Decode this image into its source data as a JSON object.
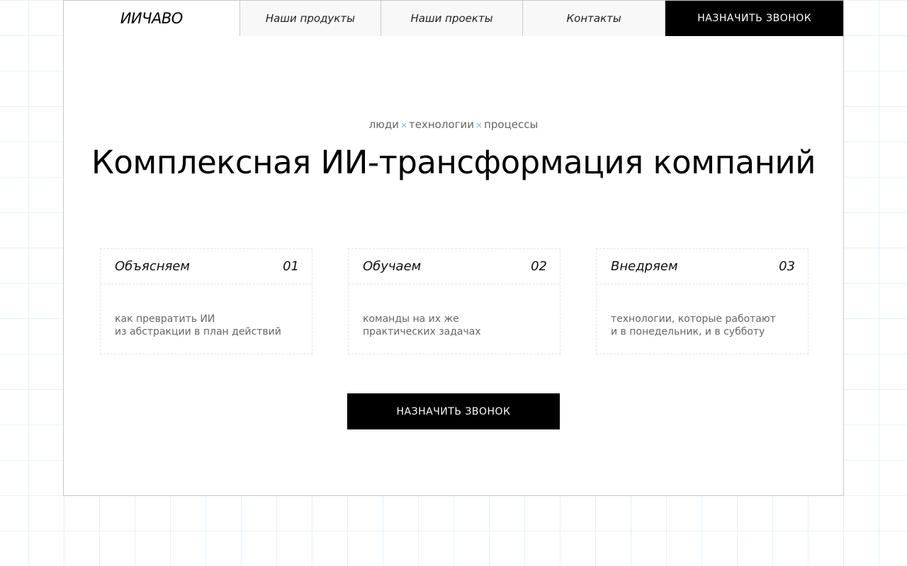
{
  "nav": {
    "logo": "ИИЧАВО",
    "items": [
      "Наши продукты",
      "Наши проекты",
      "Контакты"
    ],
    "cta": "НАЗНАЧИТЬ ЗВОНОК"
  },
  "hero": {
    "tagline": [
      "люди",
      "технологии",
      "процессы"
    ],
    "tagline_separator": "×",
    "title": "Комплексная ИИ-трансформация компаний",
    "cta": "НАЗНАЧИТЬ ЗВОНОК"
  },
  "cards": [
    {
      "title": "Объясняем",
      "number": "01",
      "lines": [
        "как превратить ИИ",
        "из абстракции в план действий"
      ]
    },
    {
      "title": "Обучаем",
      "number": "02",
      "lines": [
        "команды на их же",
        "практических задачах"
      ]
    },
    {
      "title": "Внедряем",
      "number": "03",
      "lines": [
        "технологии, которые работают",
        "и в понедельник, и в субботу"
      ]
    }
  ],
  "colors": {
    "accent": "#000000",
    "grid": "#e6f0f7",
    "separator": "#8ab4d8"
  }
}
